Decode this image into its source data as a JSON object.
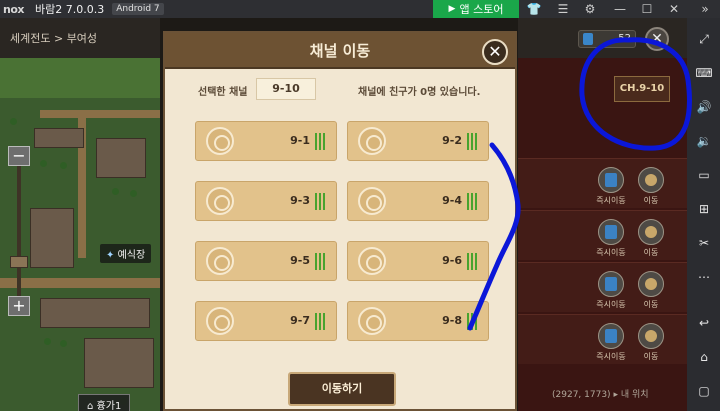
{
  "window": {
    "app_title": "바람2 7.0.0.3",
    "android_version": "Android 7",
    "store_button_label": "앱 스토어"
  },
  "map": {
    "breadcrumb": "세계전도 > 부여성",
    "place_label": "예식장",
    "region_label": "흉가1",
    "coords": "(2927, 1773)",
    "my_location_label": "내 위치"
  },
  "right_panel": {
    "coin_count": "52",
    "channel_badge": "CH.9-10",
    "rows": [
      {
        "instant_move": "즉시이동",
        "move": "이동"
      },
      {
        "instant_move": "즉시이동",
        "move": "이동"
      },
      {
        "instant_move": "즉시이동",
        "move": "이동"
      },
      {
        "instant_move": "즉시이동",
        "move": "이동"
      }
    ]
  },
  "modal": {
    "title": "채널 이동",
    "selected_label": "선택한 채널",
    "selected_value": "9-10",
    "friend_text": "채널에 친구가 0명 있습니다.",
    "move_button": "이동하기",
    "channels": [
      {
        "name": "9-1",
        "signal_bars": 3
      },
      {
        "name": "9-2",
        "signal_bars": 3
      },
      {
        "name": "9-3",
        "signal_bars": 3
      },
      {
        "name": "9-4",
        "signal_bars": 3
      },
      {
        "name": "9-5",
        "signal_bars": 3
      },
      {
        "name": "9-6",
        "signal_bars": 3
      },
      {
        "name": "9-7",
        "signal_bars": 3
      },
      {
        "name": "9-8",
        "signal_bars": 3
      }
    ]
  },
  "colors": {
    "annotation_ink": "#0b17d8",
    "signal_green": "#48a32e",
    "store_green": "#1aa74a"
  }
}
